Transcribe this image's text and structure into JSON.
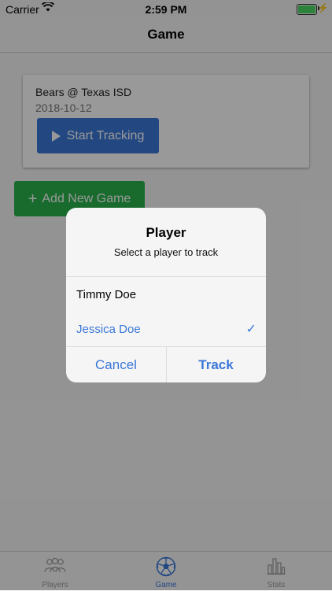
{
  "status_bar": {
    "carrier": "Carrier",
    "time": "2:59 PM"
  },
  "nav": {
    "title": "Game"
  },
  "game_card": {
    "title": "Bears @ Texas ISD",
    "date": "2018-10-12",
    "start_label": "Start Tracking"
  },
  "add_game": {
    "label": "Add New Game"
  },
  "dialog": {
    "title": "Player",
    "message": "Select a player to track",
    "options": [
      {
        "label": "Timmy Doe",
        "selected": false
      },
      {
        "label": "Jessica Doe",
        "selected": true
      }
    ],
    "cancel_label": "Cancel",
    "track_label": "Track"
  },
  "tabs": [
    {
      "label": "Players",
      "icon": "players-icon",
      "active": false
    },
    {
      "label": "Game",
      "icon": "soccer-ball-icon",
      "active": true
    },
    {
      "label": "Stats",
      "icon": "bar-chart-icon",
      "active": false
    }
  ],
  "colors": {
    "accent": "#3b78d8",
    "start_button": "#3b78d8",
    "add_button": "#2bb24c",
    "battery": "#4cd964"
  }
}
